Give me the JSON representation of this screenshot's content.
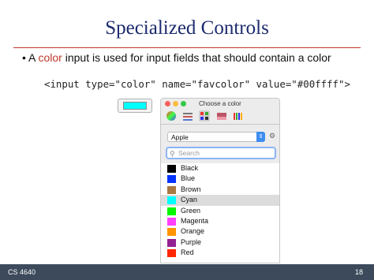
{
  "slide": {
    "title": "Specialized Controls",
    "bullet_prefix": "• A ",
    "bullet_highlight": "color",
    "bullet_suffix": " input is used for input fields that should contain a color",
    "code": "<input type=\"color\" name=\"favcolor\" value=\"#00ffff\">",
    "footer_left": "CS 4640",
    "footer_right": "18"
  },
  "input_value": "#00ffff",
  "picker": {
    "window_title": "Choose a color",
    "palette_select": "Apple",
    "search_placeholder": "Search",
    "colors": [
      {
        "name": "Black",
        "hex": "#000000"
      },
      {
        "name": "Blue",
        "hex": "#0433ff"
      },
      {
        "name": "Brown",
        "hex": "#aa7942"
      },
      {
        "name": "Cyan",
        "hex": "#00fdff"
      },
      {
        "name": "Green",
        "hex": "#00f900"
      },
      {
        "name": "Magenta",
        "hex": "#ff40ff"
      },
      {
        "name": "Orange",
        "hex": "#ff9300"
      },
      {
        "name": "Purple",
        "hex": "#942192"
      },
      {
        "name": "Red",
        "hex": "#ff2600"
      }
    ],
    "selected": "Cyan"
  },
  "colors": {
    "title": "#1c2a6e",
    "accent": "#c0392b",
    "footer": "#3c4a5c"
  }
}
